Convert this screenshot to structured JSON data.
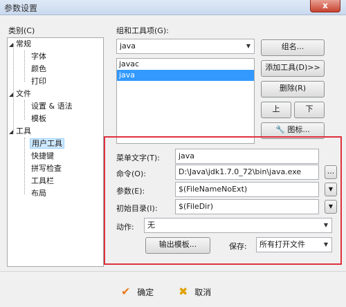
{
  "window": {
    "title": "参数设置",
    "close_label": "x"
  },
  "category": {
    "label": "类别(C)",
    "items": [
      {
        "label": "常规",
        "arrow": "◢"
      },
      {
        "label": "字体"
      },
      {
        "label": "颜色"
      },
      {
        "label": "打印"
      },
      {
        "label": "文件",
        "arrow": "◢"
      },
      {
        "label": "设置 & 语法"
      },
      {
        "label": "模板"
      },
      {
        "label": "工具",
        "arrow": "◢"
      },
      {
        "label": "用户工具"
      },
      {
        "label": "快捷键"
      },
      {
        "label": "拼写检查"
      },
      {
        "label": "工具栏"
      },
      {
        "label": "布局"
      }
    ]
  },
  "group": {
    "label": "组和工具项(G):",
    "selected": "java",
    "list": [
      "javac",
      "java"
    ],
    "btn_group_name": "组名...",
    "btn_add_tool": "添加工具(D)>>",
    "btn_delete": "删除(R)",
    "btn_up": "上",
    "btn_down": "下",
    "btn_icon": "图标..."
  },
  "form": {
    "menu_text_label": "菜单文字(T):",
    "menu_text_value": "java",
    "command_label": "命令(O):",
    "command_value": "D:\\Java\\jdk1.7.0_72\\bin\\java.exe",
    "browse_label": "...",
    "args_label": "参数(E):",
    "args_value": "$(FileNameNoExt)",
    "initdir_label": "初始目录(I):",
    "initdir_value": "$(FileDir)",
    "action_label": "动作:",
    "action_value": "无",
    "output_template": "输出模板...",
    "save_label": "保存:",
    "save_value": "所有打开文件"
  },
  "footer": {
    "ok": "确定",
    "cancel": "取消"
  },
  "colors": {
    "highlight_border": "#e0303c",
    "selection": "#3399ff"
  }
}
